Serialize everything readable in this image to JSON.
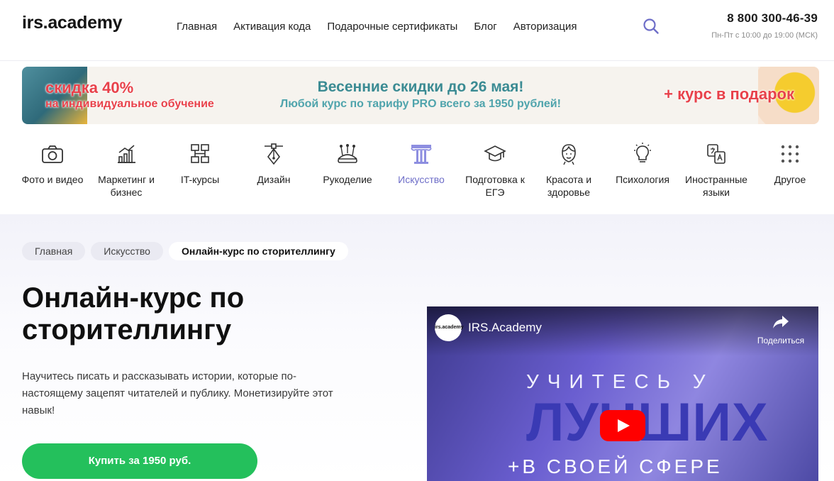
{
  "header": {
    "logo": "irs.academy",
    "nav": [
      "Главная",
      "Активация кода",
      "Подарочные сертификаты",
      "Блог",
      "Авторизация"
    ],
    "phone": "8 800 300-46-39",
    "hours": "Пн-Пт с 10:00 до 19:00 (МСК)"
  },
  "banner": {
    "discount": "скидка 40%",
    "discount_sub": "на индивидуальное обучение",
    "title": "Весенние скидки до 26 мая!",
    "subtitle": "Любой курс по тарифу PRO всего за 1950 рублей!",
    "gift": "+ курс в подарок"
  },
  "categories": [
    {
      "label": "Фото и видео",
      "icon": "camera-icon"
    },
    {
      "label": "Маркетинг и бизнес",
      "icon": "chart-icon"
    },
    {
      "label": "IT-курсы",
      "icon": "network-icon"
    },
    {
      "label": "Дизайн",
      "icon": "pen-tool-icon"
    },
    {
      "label": "Рукоделие",
      "icon": "pincushion-icon"
    },
    {
      "label": "Искусство",
      "icon": "column-icon",
      "active": true
    },
    {
      "label": "Подготовка к ЕГЭ",
      "icon": "graduation-cap-icon"
    },
    {
      "label": "Красота и здоровье",
      "icon": "face-icon"
    },
    {
      "label": "Психология",
      "icon": "lightbulb-icon"
    },
    {
      "label": "Иностранные языки",
      "icon": "translate-icon"
    },
    {
      "label": "Другое",
      "icon": "grid-dots-icon"
    }
  ],
  "breadcrumbs": [
    "Главная",
    "Искусство",
    "Онлайн-курс по сторителлингу"
  ],
  "course": {
    "title": "Онлайн-курс по сторителлингу",
    "description": "Научитесь писать и рассказывать истории, которые по-настоящему зацепят читателей и публику. Монетизируйте этот навык!",
    "buy_label": "Купить за 1950 руб."
  },
  "video": {
    "avatar_text": "irs.academy",
    "channel": "IRS.Academy",
    "share_label": "Поделиться",
    "line1": "УЧИТЕСЬ У",
    "line2": "ЛУЧШИХ",
    "line3": "+В СВОЕЙ СФЕРЕ"
  },
  "colors": {
    "accent": "#6e6ec8",
    "buy": "#24c05c",
    "promo_red": "#e8414a",
    "promo_teal": "#3b8b93"
  }
}
